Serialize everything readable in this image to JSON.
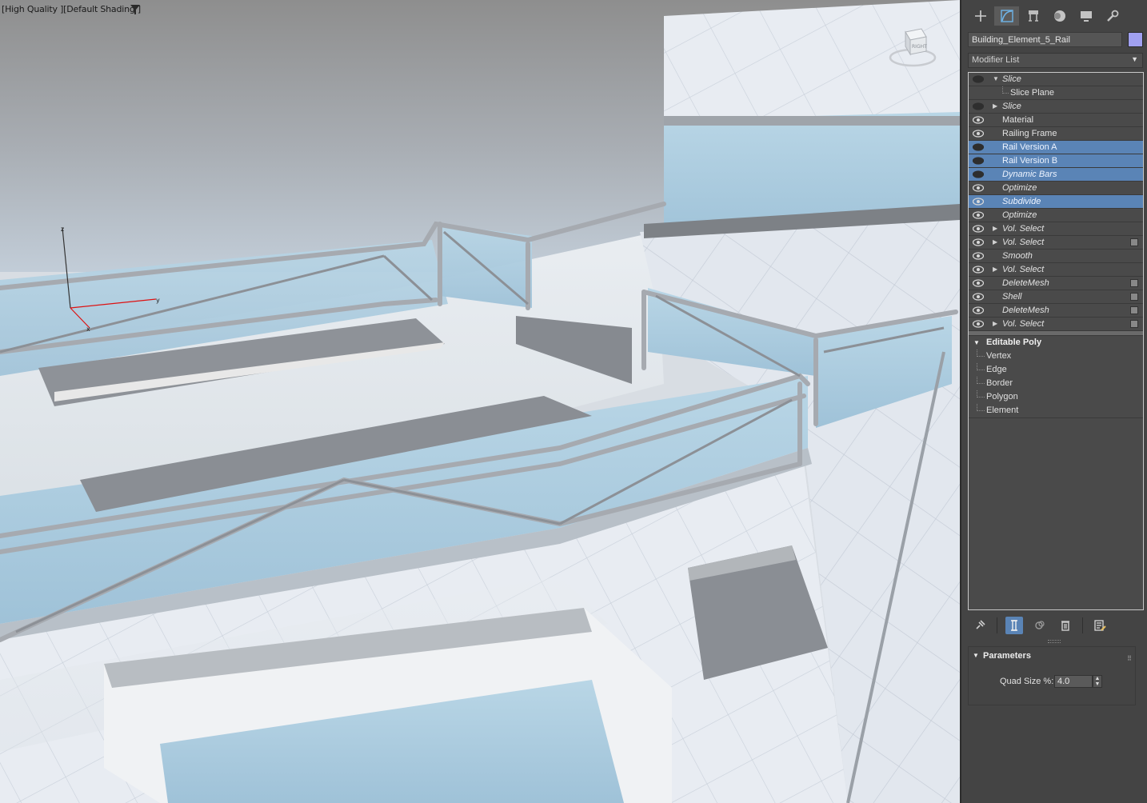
{
  "viewport": {
    "label_quality": "[High Quality ]",
    "label_shading": "[Default Shading ]",
    "viewcube_label": "RIGHT",
    "axis_labels": {
      "z": "z",
      "y": "y",
      "x": "x"
    },
    "background_colors": {
      "sky_top": "#8e8e8e",
      "sky_bottom": "#c2cdd8",
      "glass": "#a9cce0",
      "tile": "#e6ebf1"
    }
  },
  "panel": {
    "tabs": [
      {
        "name": "create",
        "icon": "plus-icon"
      },
      {
        "name": "modify",
        "icon": "modify-curve-icon"
      },
      {
        "name": "hierarchy",
        "icon": "hierarchy-icon"
      },
      {
        "name": "motion",
        "icon": "motion-circle-icon"
      },
      {
        "name": "display",
        "icon": "display-monitor-icon"
      },
      {
        "name": "utilities",
        "icon": "wrench-icon"
      }
    ],
    "object_name": "Building_Element_5_Rail",
    "object_color": "#a0a0f0",
    "modifier_list_label": "Modifier List",
    "stack": [
      {
        "label": "Slice",
        "italic": true,
        "eye": "off",
        "expander": "▼",
        "selected": false,
        "box": false
      },
      {
        "label": "Slice Plane",
        "italic": false,
        "eye": "none",
        "expander": "",
        "selected": false,
        "box": false,
        "sub": true
      },
      {
        "label": "Slice",
        "italic": true,
        "eye": "off",
        "expander": "▶",
        "selected": false,
        "box": false
      },
      {
        "label": "Material",
        "italic": false,
        "eye": "on",
        "expander": "",
        "selected": false,
        "box": false
      },
      {
        "label": "Railing Frame",
        "italic": false,
        "eye": "on",
        "expander": "",
        "selected": false,
        "box": false
      },
      {
        "label": "Rail Version A",
        "italic": false,
        "eye": "off",
        "expander": "",
        "selected": true,
        "box": false
      },
      {
        "label": "Rail Version B",
        "italic": false,
        "eye": "off",
        "expander": "",
        "selected": true,
        "box": false
      },
      {
        "label": "Dynamic Bars",
        "italic": true,
        "eye": "off",
        "expander": "",
        "selected": true,
        "box": false
      },
      {
        "label": "Optimize",
        "italic": true,
        "eye": "on",
        "expander": "",
        "selected": false,
        "box": false
      },
      {
        "label": "Subdivide",
        "italic": true,
        "eye": "on",
        "expander": "",
        "selected": true,
        "box": false
      },
      {
        "label": "Optimize",
        "italic": true,
        "eye": "on",
        "expander": "",
        "selected": false,
        "box": false
      },
      {
        "label": "Vol. Select",
        "italic": true,
        "eye": "on",
        "expander": "▶",
        "selected": false,
        "box": false
      },
      {
        "label": "Vol. Select",
        "italic": true,
        "eye": "on",
        "expander": "▶",
        "selected": false,
        "box": true
      },
      {
        "label": "Smooth",
        "italic": true,
        "eye": "on",
        "expander": "",
        "selected": false,
        "box": false
      },
      {
        "label": "Vol. Select",
        "italic": true,
        "eye": "on",
        "expander": "▶",
        "selected": false,
        "box": false
      },
      {
        "label": "DeleteMesh",
        "italic": true,
        "eye": "on",
        "expander": "",
        "selected": false,
        "box": true
      },
      {
        "label": "Shell",
        "italic": true,
        "eye": "on",
        "expander": "",
        "selected": false,
        "box": true
      },
      {
        "label": "DeleteMesh",
        "italic": true,
        "eye": "on",
        "expander": "",
        "selected": false,
        "box": true
      },
      {
        "label": "Vol. Select",
        "italic": true,
        "eye": "on",
        "expander": "▶",
        "selected": false,
        "box": true
      }
    ],
    "base_object": {
      "label": "Editable Poly",
      "expander": "▼",
      "subobjects": [
        "Vertex",
        "Edge",
        "Border",
        "Polygon",
        "Element"
      ]
    },
    "stack_tools": [
      {
        "name": "pin-stack",
        "icon": "pin-icon",
        "active": false
      },
      {
        "name": "show-end-result",
        "icon": "show-end-result-icon",
        "active": true
      },
      {
        "name": "make-unique",
        "icon": "make-unique-icon",
        "active": false
      },
      {
        "name": "remove-modifier",
        "icon": "trash-icon",
        "active": false
      },
      {
        "name": "configure-modifier-sets",
        "icon": "configure-sets-icon",
        "active": false
      }
    ],
    "parameters": {
      "title": "Parameters",
      "expander": "▼",
      "quad_size_label": "Quad Size %:",
      "quad_size_value": "4.0"
    }
  }
}
